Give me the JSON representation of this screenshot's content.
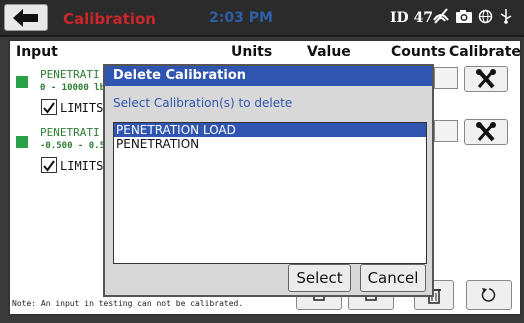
{
  "topbar": {
    "title": "Calibration",
    "time": "2:03 PM",
    "device_id": "ID 47",
    "colors": {
      "title": "#c8262a",
      "time": "#2e5fa8"
    },
    "icons": [
      "back-arrow-icon",
      "no-wifi-icon",
      "camera-icon",
      "globe-icon",
      "usb-icon"
    ]
  },
  "table": {
    "headers": {
      "input": "Input",
      "units": "Units",
      "value": "Value",
      "counts": "Counts",
      "calibrate": "Calibrate"
    },
    "rows": [
      {
        "name": "PENETRATI",
        "range": "0 - 10000 lb",
        "limits_label": "LIMITS",
        "limits_checked": true
      },
      {
        "name": "PENETRATI",
        "range": "-0.500 - 0.5",
        "limits_label": "LIMITS",
        "limits_checked": true
      }
    ]
  },
  "note": "Note:  An input in testing can not be calibrated.",
  "dialog": {
    "title": "Delete Calibration",
    "subtitle": "Select Calibration(s) to delete",
    "items": [
      {
        "label": "PENETRATION LOAD",
        "selected": true
      },
      {
        "label": "PENETRATION",
        "selected": false
      }
    ],
    "select_label": "Select",
    "cancel_label": "Cancel",
    "colors": {
      "titlebar": "#2f55b0",
      "selection": "#2f55b0"
    }
  }
}
